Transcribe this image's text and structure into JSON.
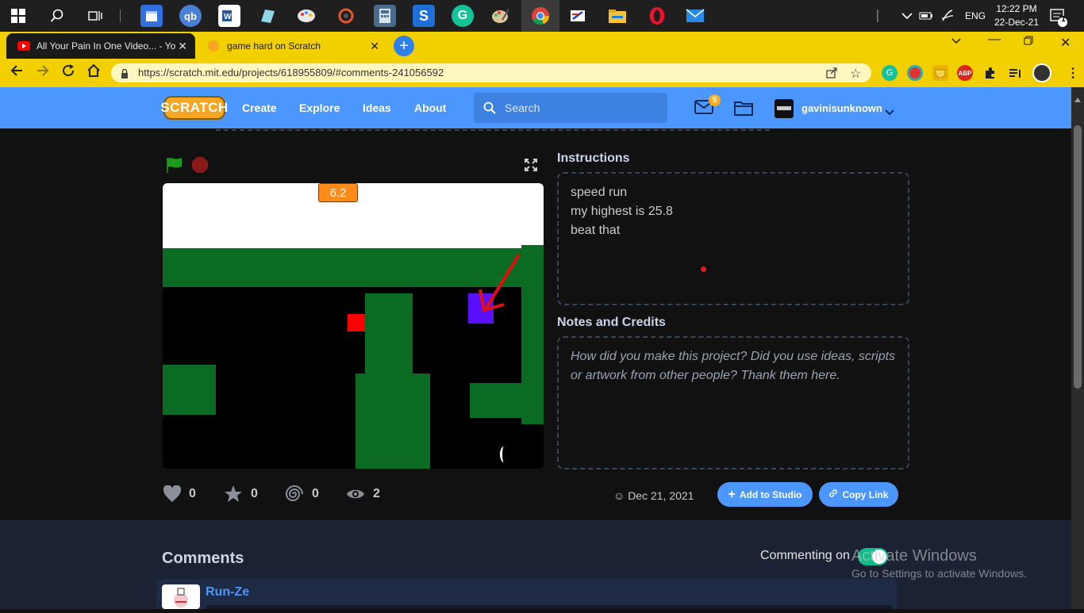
{
  "taskbar": {
    "icons": [
      "windows-logo-icon",
      "search-icon",
      "task-view-icon",
      "calendar-app-icon",
      "qb-app-icon",
      "word-app-icon",
      "notes-app-icon",
      "paint-app-icon",
      "sync-app-icon",
      "calculator-app-icon",
      "s-app-icon",
      "grammarly-app-icon",
      "paint-brush-app-icon",
      "chrome-app-icon",
      "draw-app-icon",
      "file-explorer-icon",
      "opera-app-icon",
      "mail-app-icon"
    ],
    "qb_label": "qb",
    "language": "ENG",
    "time": "12:22 PM",
    "date": "22-Dec-21",
    "notification_count": "1"
  },
  "browser": {
    "tabs": [
      {
        "title": "All Your Pain In One Video... - You"
      },
      {
        "title": "game hard on Scratch"
      }
    ],
    "url": "https://scratch.mit.edu/projects/618955809/#comments-241056592",
    "abp_label": "ABP"
  },
  "scratch_nav": {
    "logo": "SCRATCH",
    "links": [
      "Create",
      "Explore",
      "Ideas",
      "About"
    ],
    "search_placeholder": "Search",
    "message_count": "5",
    "username": "gavinisunknown"
  },
  "project": {
    "timer": "6.2",
    "instructions_heading": "Instructions",
    "instructions_lines": [
      "speed run",
      "my highest is 25.8",
      "beat that"
    ],
    "notes_heading": "Notes and Credits",
    "notes_placeholder": "How did you make this project? Did you use ideas, scripts or artwork from other people? Thank them here.",
    "stats": {
      "loves": "0",
      "favorites": "0",
      "remixes": "0",
      "views": "2"
    },
    "date": "Dec 21, 2021",
    "add_to_studio": "Add to Studio",
    "copy_link": "Copy Link"
  },
  "comments": {
    "heading": "Comments",
    "commenting_toggle": "Commenting on",
    "first_author": "Run-Ze"
  },
  "watermark": {
    "line1": "Activate Windows",
    "line2": "Go to Settings to activate Windows."
  },
  "colors": {
    "scratch_blue": "#4c97ff",
    "chrome_yellow": "#f2d000",
    "game_green": "#0b6b23",
    "player_red": "#ff0000",
    "goal_purple": "#5a10ff"
  }
}
